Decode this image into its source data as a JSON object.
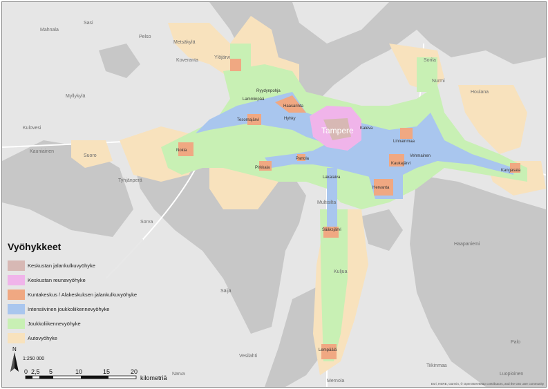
{
  "legend": {
    "title": "Vyöhykkeet",
    "items": [
      {
        "label": "Keskustan jalankulkuvyöhyke",
        "color": "#d7b8b4"
      },
      {
        "label": "Keskustan reunavyöhyke",
        "color": "#f0b4ea"
      },
      {
        "label": "Kuntakeskus / Alakeskuksen jalankulkuvyöhyke",
        "color": "#f0a882"
      },
      {
        "label": "Intensiivinen joukkoliikennevyöhyke",
        "color": "#a9c6ee"
      },
      {
        "label": "Joukkoliikennevyöhyke",
        "color": "#c8f0b4"
      },
      {
        "label": "Autovyöhyke",
        "color": "#f8e2bd"
      }
    ]
  },
  "scale": {
    "ratio": "1:250 000",
    "north": "N",
    "ticks": [
      "0",
      "2,5",
      "5",
      "10",
      "15",
      "20"
    ],
    "unit": "kilometriä"
  },
  "attribution": "Esri, HERE, Garmin, © OpenStreetMap contributors, and the GIS user community",
  "places": {
    "mahnala": "Mahnala",
    "sasi": "Sasi",
    "pelso": "Pelso",
    "metsakyla": "Metsäkylä",
    "ylojarvi": "Ylöjärvi",
    "koveranta": "Koveranta",
    "myllykyla": "Myllykylä",
    "ryydynpohja": "Ryydynpohja",
    "lamminpaa": "Lamminpää",
    "haasarinta": "Haasarinta",
    "tesoma": "Tesomajärvi",
    "hyhky": "Hyhky",
    "kulovesi": "Kulovesi",
    "kauniainen": "Kauniainen",
    "suoro": "Suoro",
    "nokia": "Nokia",
    "tyhjanpera": "Tyhjänperä",
    "tampere": "Tampere",
    "kaleva": "Kaleva",
    "pirkkala": "Pirkkala",
    "partola": "Partola",
    "lakalaiva": "Lakalaiva",
    "multisilta": "Multisilta",
    "sorva": "Sorva",
    "saaskjarvi": "Sääksjärvi",
    "kuljua": "Kuljua",
    "saija": "Säijä",
    "vesilahti": "Vesilahti",
    "narva": "Narva",
    "lempaala": "Lempäälä",
    "nurmi": "Nurmi",
    "sorila": "Sorila",
    "houlana": "Houlana",
    "linnainmaa": "Linnainmaa",
    "vehmainen": "Vehmainen",
    "kaukajarvi": "Kaukajärvi",
    "kangasala": "Kangasala",
    "hervanta": "Hervanta",
    "haapaniemi": "Haapaniemi",
    "palo": "Palo",
    "tiikinmaa": "Tiikinmaa",
    "luopio": "Luopioinen",
    "mernola": "Mernola"
  }
}
